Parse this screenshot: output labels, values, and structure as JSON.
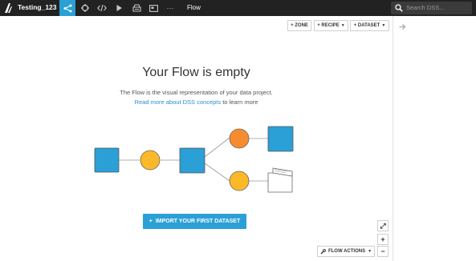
{
  "topbar": {
    "project_name": "Testing_123",
    "nav_icons": [
      "flow-icon",
      "target-icon",
      "code-icon",
      "play-icon",
      "notebook-icon",
      "dashboard-icon",
      "more-icon"
    ],
    "active_label": "Flow",
    "more_label": "···",
    "search_placeholder": "Search DSS..."
  },
  "toolbar": {
    "zone_label": "+ ZONE",
    "recipe_label": "+ RECIPE",
    "dataset_label": "+ DATASET"
  },
  "empty_state": {
    "title": "Your Flow is empty",
    "description": "The Flow is the visual representation of your data project.",
    "link_text": "Read more about DSS concepts",
    "link_suffix": " to learn more"
  },
  "import_button": {
    "icon": "+",
    "label": "IMPORT YOUR FIRST DATASET"
  },
  "controls": {
    "fullscreen_icon": "⤢",
    "zoom_in": "+",
    "zoom_out": "−",
    "flow_actions_label": "FLOW ACTIONS"
  },
  "colors": {
    "accent": "#2aa0d6",
    "topbar_bg": "#222222",
    "dataset_blue": "#2aa0d6",
    "recipe_yellow": "#fbb829",
    "recipe_orange": "#f68c2e"
  }
}
